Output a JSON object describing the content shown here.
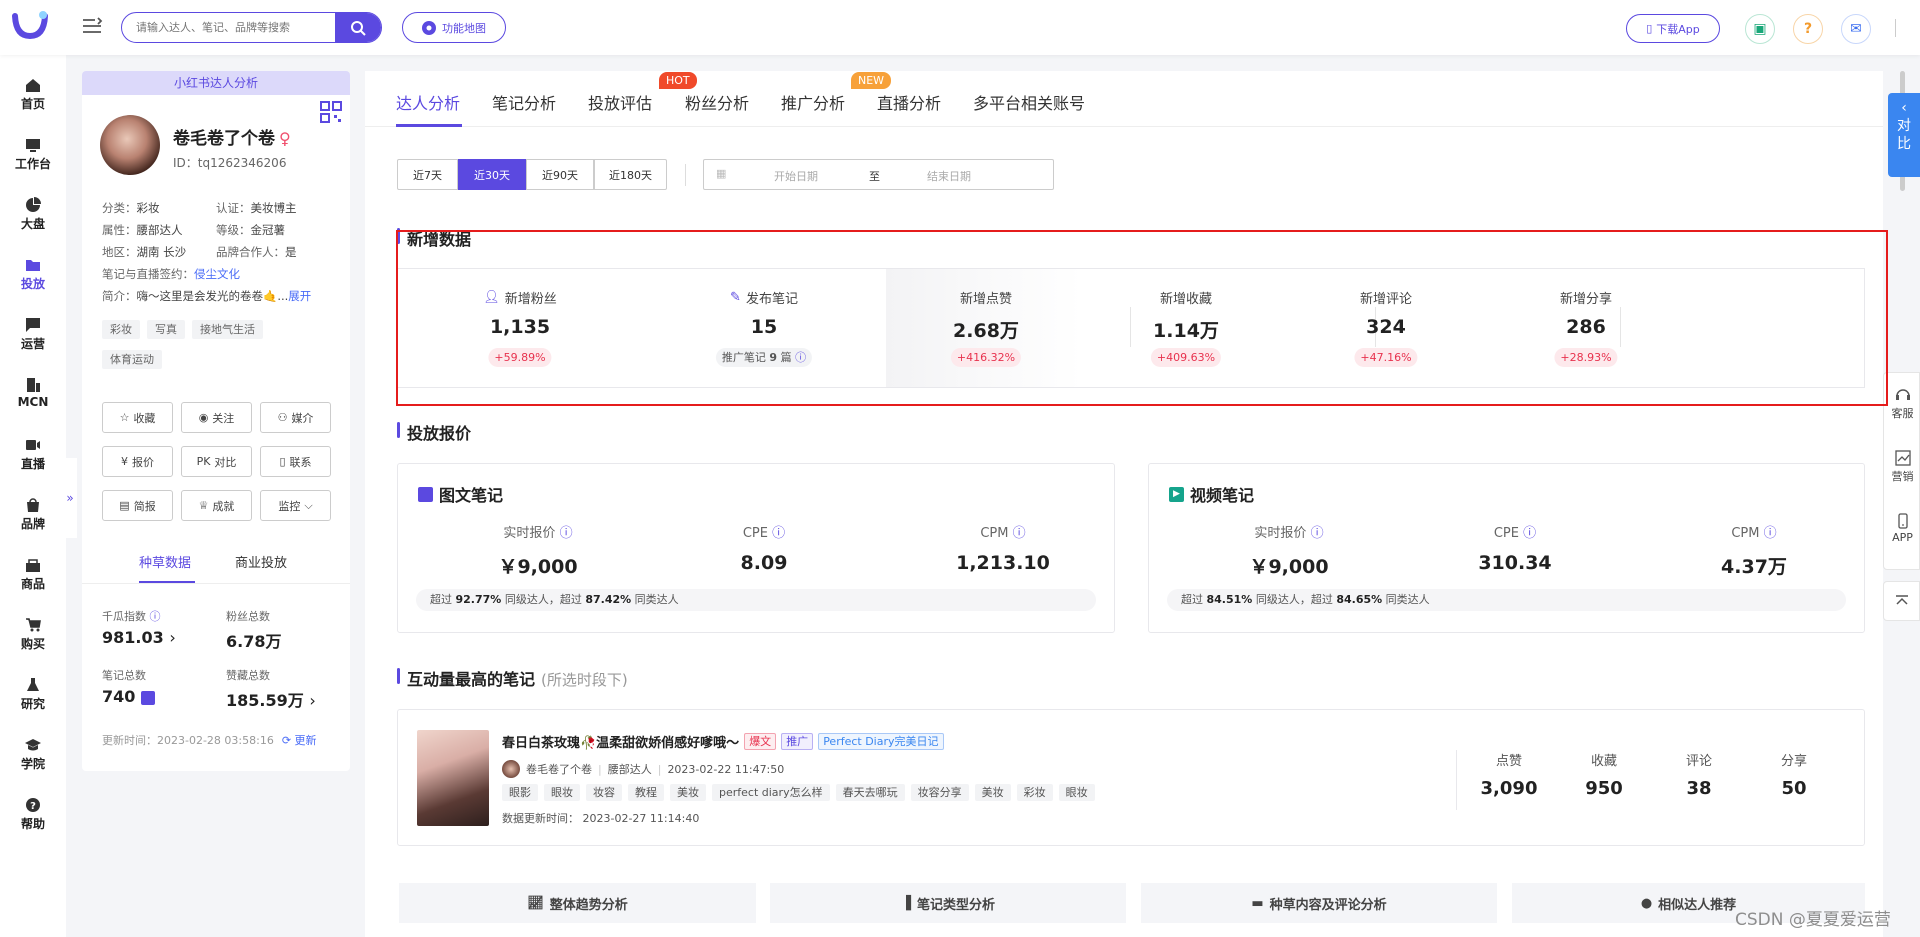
{
  "topbar": {
    "search_placeholder": "请输入达人、笔记、品牌等搜索",
    "funcmap_label": "功能地图",
    "download_app_label": "下载App"
  },
  "leftnav": [
    {
      "label": "首页",
      "icon": "home-icon"
    },
    {
      "label": "工作台",
      "icon": "workbench-icon"
    },
    {
      "label": "大盘",
      "icon": "pie-chart-icon"
    },
    {
      "label": "投放",
      "icon": "folder-icon",
      "active": true
    },
    {
      "label": "运营",
      "icon": "chat-chart-icon"
    },
    {
      "label": "MCN",
      "icon": "building-icon"
    },
    {
      "label": "直播",
      "icon": "video-icon"
    },
    {
      "label": "品牌",
      "icon": "bag-icon"
    },
    {
      "label": "商品",
      "icon": "shop-icon"
    },
    {
      "label": "购买",
      "icon": "cart-icon"
    },
    {
      "label": "研究",
      "icon": "flask-icon"
    },
    {
      "label": "学院",
      "icon": "graduation-cap-icon"
    },
    {
      "label": "帮助",
      "icon": "help-icon"
    }
  ],
  "profile": {
    "header": "小红书达人分析",
    "name": "卷毛卷了个卷",
    "sex_symbol": "♀",
    "id": "ID：tq1262346206",
    "category_label": "分类：",
    "category": "彩妆",
    "cert_label": "认证：",
    "cert": "美妆博主",
    "attr_label": "属性：",
    "attr": "腰部达人",
    "level_label": "等级：",
    "level": "金冠薯",
    "region_label": "地区：",
    "region": "湖南 长沙",
    "brand_label": "品牌合作人：",
    "brand": "是",
    "sign_label": "笔记与直播签约：",
    "sign": "侵尘文化",
    "intro_label": "简介：",
    "intro": "嗨～这里是会发光的卷卷🤙...",
    "expand": "展开",
    "tags": [
      "彩妆",
      "写真",
      "接地气生活",
      "体育运动"
    ],
    "actions": [
      "收藏",
      "关注",
      "媒介",
      "报价",
      "对比",
      "联系",
      "简报",
      "成就",
      "监控"
    ],
    "pk_prefix": "PK",
    "tabs": [
      "种草数据",
      "商业投放"
    ],
    "stats": [
      {
        "label": "千瓜指数",
        "value": "981.03"
      },
      {
        "label": "粉丝总数",
        "value": "6.78万"
      },
      {
        "label": "笔记总数",
        "value": "740"
      },
      {
        "label": "赞藏总数",
        "value": "185.59万"
      }
    ],
    "update_time": "更新时间：2023-02-28 03:58:16",
    "update_label": "更新"
  },
  "tabs": [
    {
      "label": "达人分析",
      "active": true
    },
    {
      "label": "笔记分析"
    },
    {
      "label": "投放评估"
    },
    {
      "label": "粉丝分析",
      "badge": "HOT"
    },
    {
      "label": "推广分析"
    },
    {
      "label": "直播分析",
      "badge": "NEW"
    },
    {
      "label": "多平台相关账号"
    }
  ],
  "colors": {
    "brand": "#5b49e0",
    "hot": "#f04a2a",
    "new": "#f7a13a",
    "up": "#e8324e",
    "compare": "#3a86f0"
  },
  "range_buttons": [
    "近7天",
    "近30天",
    "近90天",
    "近180天"
  ],
  "range_active": "近30天",
  "date": {
    "start": "开始日期",
    "sep": "至",
    "end": "结束日期"
  },
  "new_data": {
    "title": "新增数据",
    "items": [
      {
        "label": "新增粉丝",
        "value": "1,135",
        "change": "+59.89%"
      },
      {
        "label": "发布笔记",
        "value": "15",
        "sub_prefix": "推广笔记",
        "sub_value": "9",
        "sub_suffix": "篇"
      },
      {
        "label": "新增点赞",
        "value": "2.68万",
        "change": "+416.32%"
      },
      {
        "label": "新增收藏",
        "value": "1.14万",
        "change": "+409.63%"
      },
      {
        "label": "新增评论",
        "value": "324",
        "change": "+47.16%"
      },
      {
        "label": "新增分享",
        "value": "286",
        "change": "+28.93%"
      }
    ]
  },
  "quote": {
    "title": "投放报价",
    "cards": [
      {
        "title": "图文笔记",
        "labels": [
          "实时报价",
          "CPE",
          "CPM"
        ],
        "values": [
          "￥9,000",
          "8.09",
          "1,213.10"
        ],
        "bar": {
          "p1": "超过",
          "v1": "92.77%",
          "p2": "同级达人，超过",
          "v2": "87.42%",
          "p3": "同类达人"
        }
      },
      {
        "title": "视频笔记",
        "labels": [
          "实时报价",
          "CPE",
          "CPM"
        ],
        "values": [
          "￥9,000",
          "310.34",
          "4.37万"
        ],
        "bar": {
          "p1": "超过",
          "v1": "84.51%",
          "p2": "同级达人，超过",
          "v2": "84.65%",
          "p3": "同类达人"
        }
      }
    ]
  },
  "top_note": {
    "title": "互动量最高的笔记",
    "subtitle": "(所选时段下)",
    "note_title": "春日白茶玫瑰🥀温柔甜欲娇俏感好嗲哦～",
    "badges": [
      "爆文",
      "推广",
      "Perfect Diary完美日记"
    ],
    "author": "卷毛卷了个卷",
    "author_level": "腰部达人",
    "time": "2023-02-22 11:47:50",
    "tags": [
      "眼影",
      "眼妆",
      "妆容",
      "教程",
      "美妆",
      "perfect diary怎么样",
      "春天去哪玩",
      "妆容分享",
      "美妆",
      "彩妆",
      "眼妆"
    ],
    "update": "数据更新时间：  2023-02-27 11:14:40",
    "stats": [
      {
        "label": "点赞",
        "value": "3,090"
      },
      {
        "label": "收藏",
        "value": "950"
      },
      {
        "label": "评论",
        "value": "38"
      },
      {
        "label": "分享",
        "value": "50"
      }
    ]
  },
  "bottom_tabs": [
    "整体趋势分析",
    "笔记类型分析",
    "种草内容及评论分析",
    "相似达人推荐"
  ],
  "compare_label": "对比",
  "right_panel": [
    "客服",
    "营销",
    "APP"
  ],
  "watermark": "CSDN @夏夏爱运营"
}
